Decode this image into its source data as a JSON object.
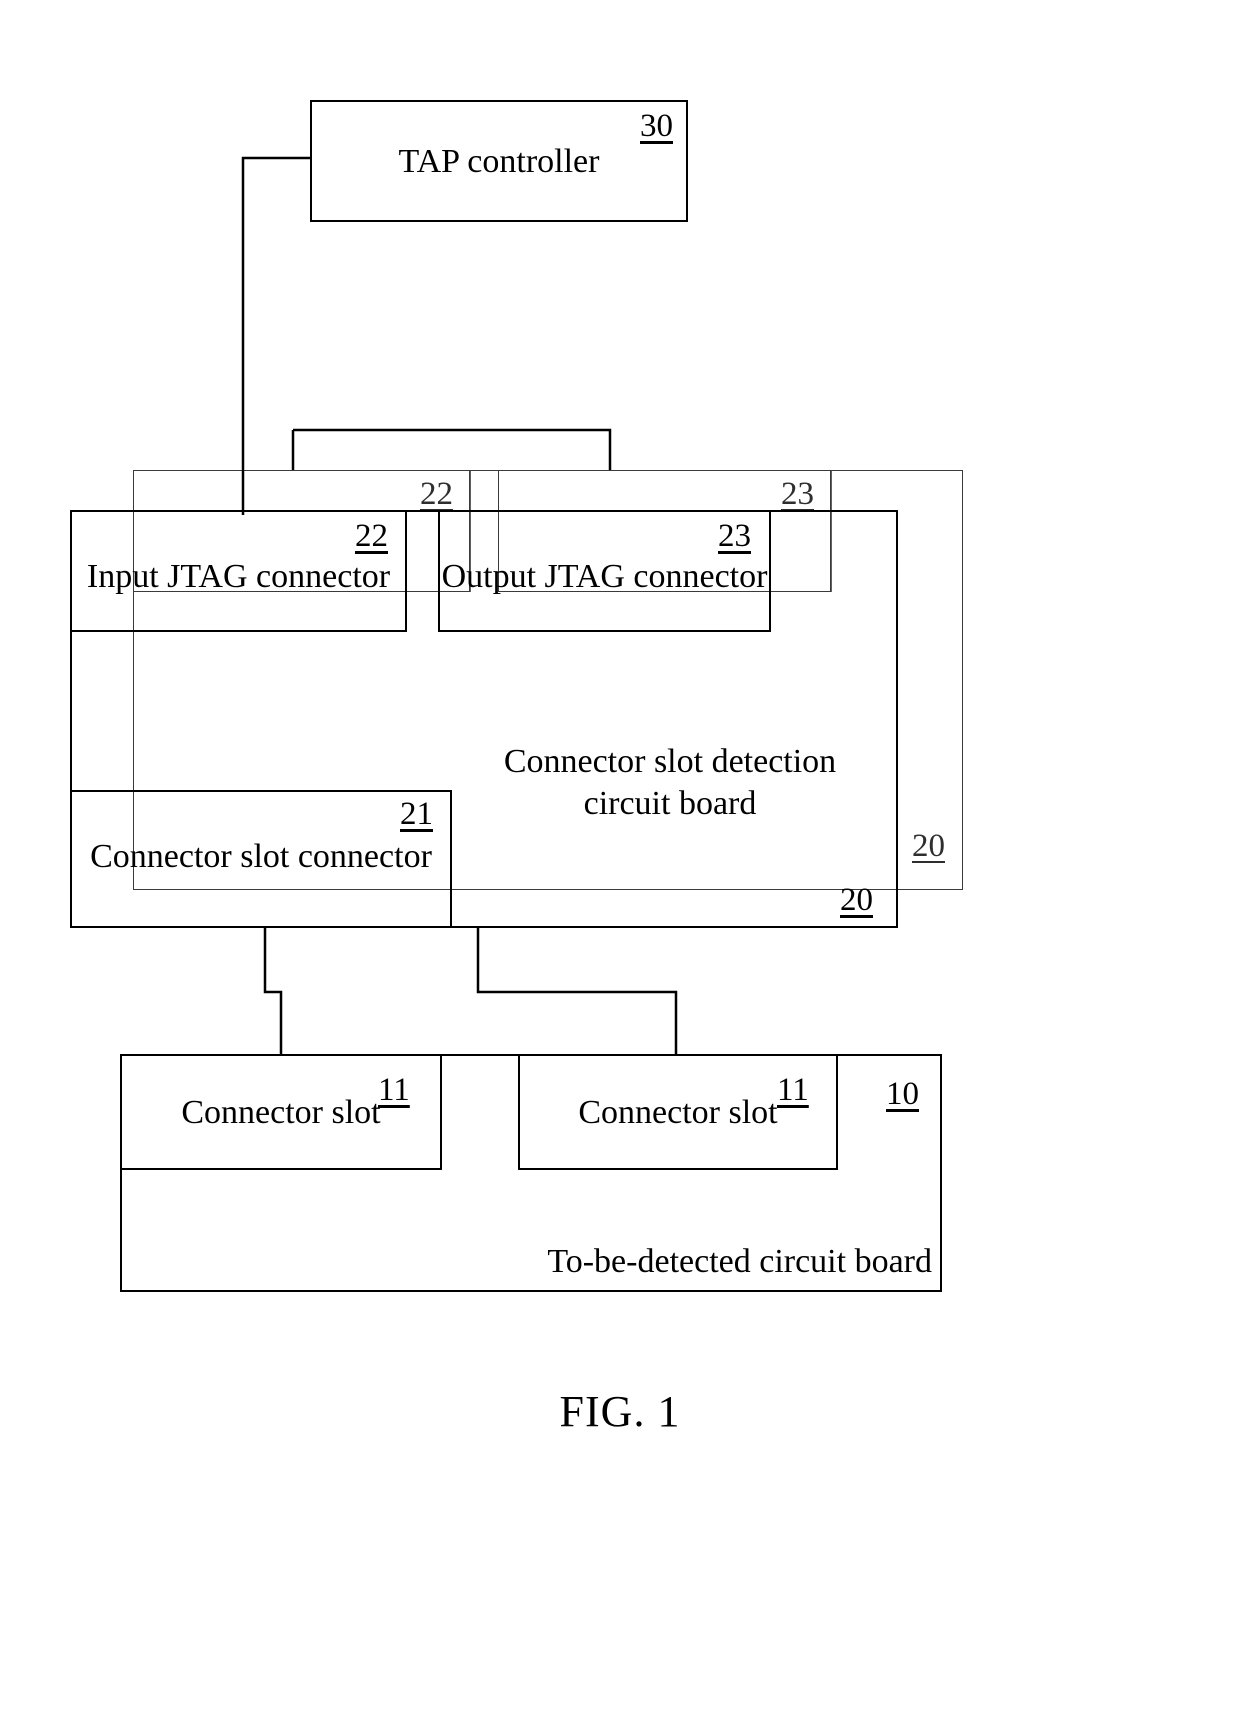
{
  "figure": {
    "caption": "FIG. 1",
    "type": "patent-block-diagram"
  },
  "blocks": {
    "tap_controller": {
      "label": "TAP controller",
      "ref": "30"
    },
    "detection_board": {
      "label": "Connector slot detection\ncircuit board",
      "label_line1": "Connector slot detection",
      "label_line2": "circuit board",
      "ref": "20",
      "ref_ghost": "20"
    },
    "input_jtag": {
      "label": "Input JTAG connector",
      "ref": "22",
      "ref_ghost": "22"
    },
    "output_jtag": {
      "label": "Output JTAG connector",
      "ref": "23",
      "ref_ghost": "23"
    },
    "slot_connector": {
      "label": "Connector slot connector",
      "ref": "21"
    },
    "target_board": {
      "label": "To-be-detected circuit board",
      "ref": "10"
    },
    "connector_slot_left": {
      "label": "Connector slot",
      "ref": "11"
    },
    "connector_slot_right": {
      "label": "Connector slot",
      "ref": "11"
    }
  },
  "colors": {
    "stroke": "#000000",
    "ghost_stroke": "#3a3a3a",
    "background": "#ffffff"
  }
}
